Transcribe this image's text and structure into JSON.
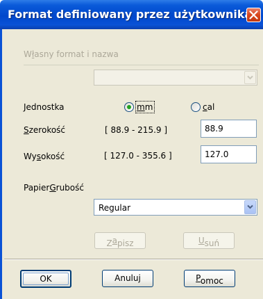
{
  "window": {
    "title": "Format definiowany przez użytkownika",
    "close_icon": "close-icon",
    "accent_color": "#0a52d6",
    "close_color": "#d8461c"
  },
  "custom_format": {
    "label_prefix": "W",
    "label_accel": "ł",
    "label_rest": "asny format i nazwa",
    "combo_value": "",
    "enabled": false
  },
  "unit": {
    "label": "Jednostka",
    "options": [
      {
        "accel": "m",
        "rest": "m",
        "selected": true
      },
      {
        "accel": "c",
        "rest": "al",
        "selected": false
      }
    ]
  },
  "width": {
    "label_accel": "S",
    "label_rest": "zerokość",
    "range": "[ 88.9 - 215.9 ]",
    "value": "88.9"
  },
  "height": {
    "label_prefix": "Wy",
    "label_accel": "s",
    "label_rest": "okość",
    "range": "[ 127.0 - 355.6 ]",
    "value": "127.0"
  },
  "thickness": {
    "label_prefix": "Papier",
    "label_accel": "G",
    "label_rest": "rubość",
    "selected": "Regular"
  },
  "actions": {
    "save_prefix": "Z",
    "save_accel": "a",
    "save_rest": "pisz",
    "delete_accel": "U",
    "delete_rest": "suń"
  },
  "footer": {
    "ok": "OK",
    "cancel": "Anuluj",
    "help_accel": "P",
    "help_rest": "omoc"
  }
}
